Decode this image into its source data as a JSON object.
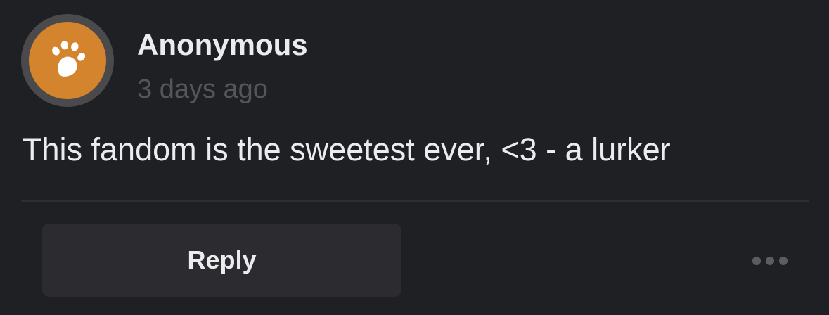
{
  "comment": {
    "author": "Anonymous",
    "timestamp": "3 days ago",
    "body": "This fandom is the sweetest ever, <3 - a lurker",
    "avatar_icon": "paw-icon"
  },
  "actions": {
    "reply_label": "Reply",
    "more_icon": "more-horizontal-icon"
  },
  "colors": {
    "background": "#1f2024",
    "avatar_accent": "#d4842c",
    "avatar_ring": "#4a4a4d",
    "button_bg": "#2b2b30",
    "text_primary": "#ececef",
    "text_muted": "#55565b"
  }
}
